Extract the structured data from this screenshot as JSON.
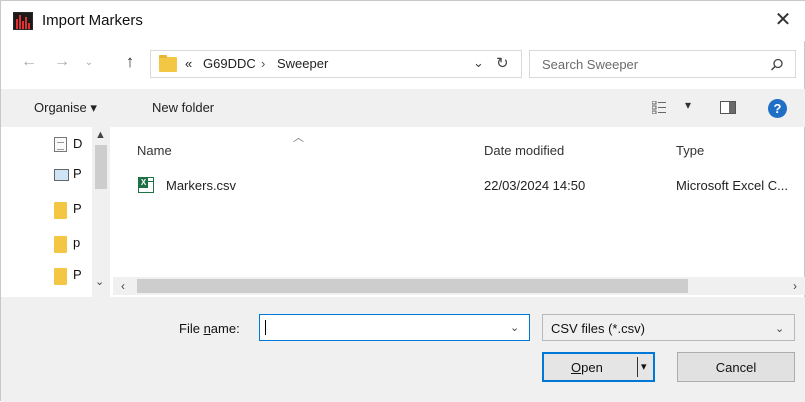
{
  "window": {
    "title": "Import Markers"
  },
  "nav": {
    "breadcrumb_prefix": "«",
    "breadcrumbs": [
      "G69DDC",
      "Sweeper"
    ],
    "crumb_separator": "›",
    "search_placeholder": "Search Sweeper"
  },
  "toolbar": {
    "organise_label": "Organise ▾",
    "new_folder_label": "New folder"
  },
  "left_pane": {
    "items": [
      {
        "label": "D",
        "icon": "document-icon"
      },
      {
        "label": "P",
        "icon": "pictures-icon"
      },
      {
        "label": "P",
        "icon": "folder-icon"
      },
      {
        "label": "p",
        "icon": "folder-icon"
      },
      {
        "label": "P",
        "icon": "folder-icon"
      }
    ]
  },
  "file_list": {
    "columns": {
      "name": "Name",
      "date": "Date modified",
      "type": "Type"
    },
    "rows": [
      {
        "name": "Markers.csv",
        "date": "22/03/2024 14:50",
        "type": "Microsoft Excel C..."
      }
    ]
  },
  "footer": {
    "file_name_label_pre": "File ",
    "file_name_label_u": "n",
    "file_name_label_post": "ame:",
    "file_name_value": "",
    "filter_value": "CSV files (*.csv)",
    "open_label_u": "O",
    "open_label_rest": "pen",
    "cancel_label": "Cancel"
  },
  "colors": {
    "accent": "#0078d7",
    "folder": "#f3c744",
    "excel_green": "#1e7145",
    "help_blue": "#1f6fc6"
  }
}
